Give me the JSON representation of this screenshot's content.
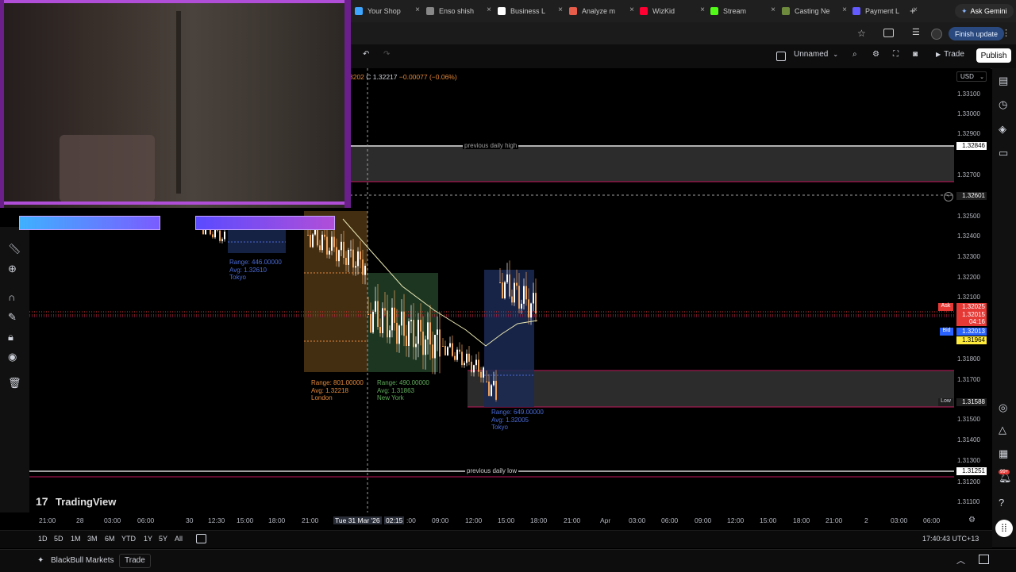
{
  "browser": {
    "tabs": [
      {
        "label": "Your Shop",
        "color": "#3ea6ff"
      },
      {
        "label": "Enso shish",
        "color": "#888888"
      },
      {
        "label": "Business L",
        "color": "#ffffff"
      },
      {
        "label": "Analyze m",
        "color": "#e85d4a"
      },
      {
        "label": "WizKid",
        "color": "#ff0033"
      },
      {
        "label": "Stream",
        "color": "#53fc18"
      },
      {
        "label": "Casting Ne",
        "color": "#6e8b3d"
      },
      {
        "label": "Payment L",
        "color": "#635bff"
      }
    ],
    "new_tab": "+",
    "ask_gemini": "Ask Gemini",
    "finish_update": "Finish update"
  },
  "toolbar": {
    "layout_name": "Unnamed",
    "trade": "Trade",
    "publish": "Publish",
    "undo": "↶",
    "redo": "↷"
  },
  "quote": {
    "prefix": "3202",
    "close": "C 1.32217",
    "change": "−0.00077 (−0.06%)"
  },
  "currency": "USD",
  "price_axis": [
    "1.33100",
    "1.33000",
    "1.32900",
    "1.32700",
    "1.32500",
    "1.32400",
    "1.32300",
    "1.32200",
    "1.32100",
    "1.31800",
    "1.31700",
    "1.31500",
    "1.31400",
    "1.31300",
    "1.31200",
    "1.31100"
  ],
  "price_tags": {
    "prev_high": "1.32846",
    "crosshair": "1.32601",
    "ask_label": "Ask",
    "ask": "1.32025",
    "last": "1.32015",
    "countdown": "04:16",
    "bid_label": "Bid",
    "bid": "1.32013",
    "yellow": "1.31964",
    "low_label": "Low",
    "low": "1.31588",
    "prev_low": "1.31251"
  },
  "lines": {
    "prev_high": "previous daily high",
    "prev_low": "previous daily low"
  },
  "sessions": [
    {
      "range": "Range: 446.00000",
      "avg": "Avg: 1.32610",
      "name": "Tokyo",
      "color": "#4a6bd8"
    },
    {
      "range": "Range: 801.00000",
      "avg": "Avg: 1.32218",
      "name": "London",
      "color": "#e3883a"
    },
    {
      "range": "Range: 490.00000",
      "avg": "Avg: 1.31863",
      "name": "New York",
      "color": "#5fae5b"
    },
    {
      "range": "Range: 649.00000",
      "avg": "Avg: 1.32005",
      "name": "Tokyo",
      "color": "#4a6bd8"
    }
  ],
  "logo": "TradingView",
  "time_axis": [
    "21:00",
    "28",
    "03:00",
    "06:00",
    "30",
    "12:30",
    "15:00",
    "18:00",
    "21:00",
    "Tue 31 Mar '26",
    "02:15",
    ":00",
    "09:00",
    "12:00",
    "15:00",
    "18:00",
    "21:00",
    "Apr",
    "03:00",
    "06:00",
    "09:00",
    "12:00",
    "15:00",
    "18:00",
    "21:00",
    "2",
    "03:00",
    "06:00"
  ],
  "ranges": [
    "1D",
    "5D",
    "1M",
    "3M",
    "6M",
    "YTD",
    "1Y",
    "5Y",
    "All"
  ],
  "clock": "17:40:43 UTC+13",
  "broker": "BlackBull Markets",
  "broker_trade": "Trade",
  "notifications": "99+"
}
